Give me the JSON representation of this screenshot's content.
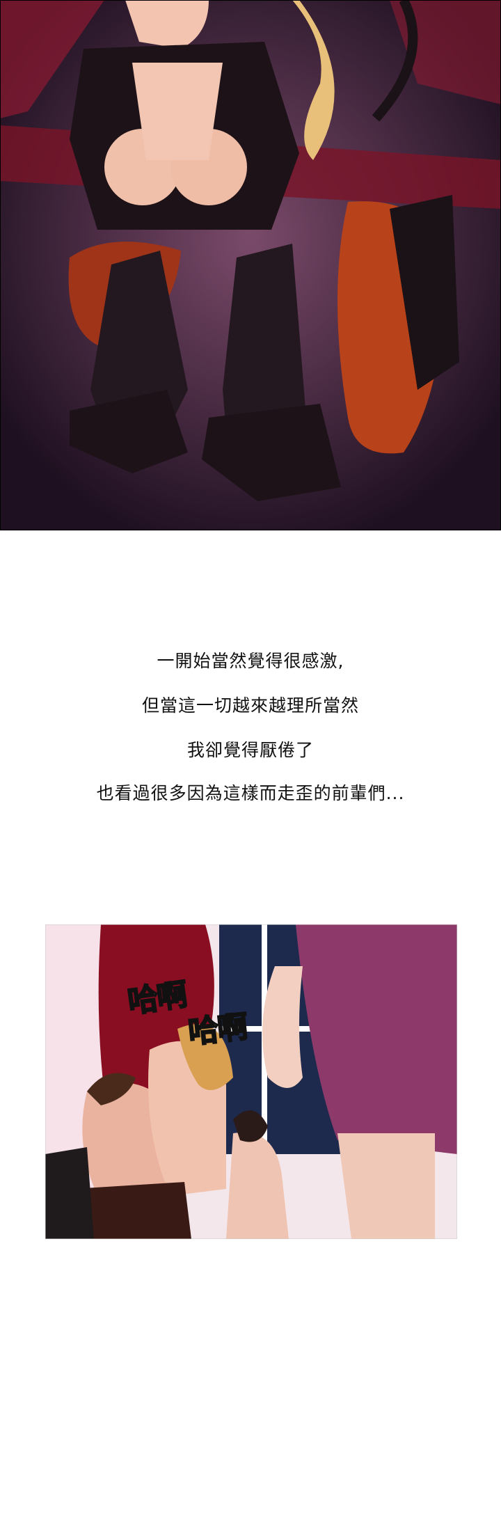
{
  "narration": [
    "一開始當然覺得很感激,",
    "但當這一切越來越理所當然",
    "我卻覺得厭倦了",
    "也看過很多因為這樣而走歪的前輩們..."
  ],
  "sfx": [
    "哈啊",
    "哈啊"
  ],
  "colors": {
    "top_panel_bg": "#3c0c1a",
    "bottom_panel_bg": "#f1e6ea",
    "text": "#111111"
  }
}
